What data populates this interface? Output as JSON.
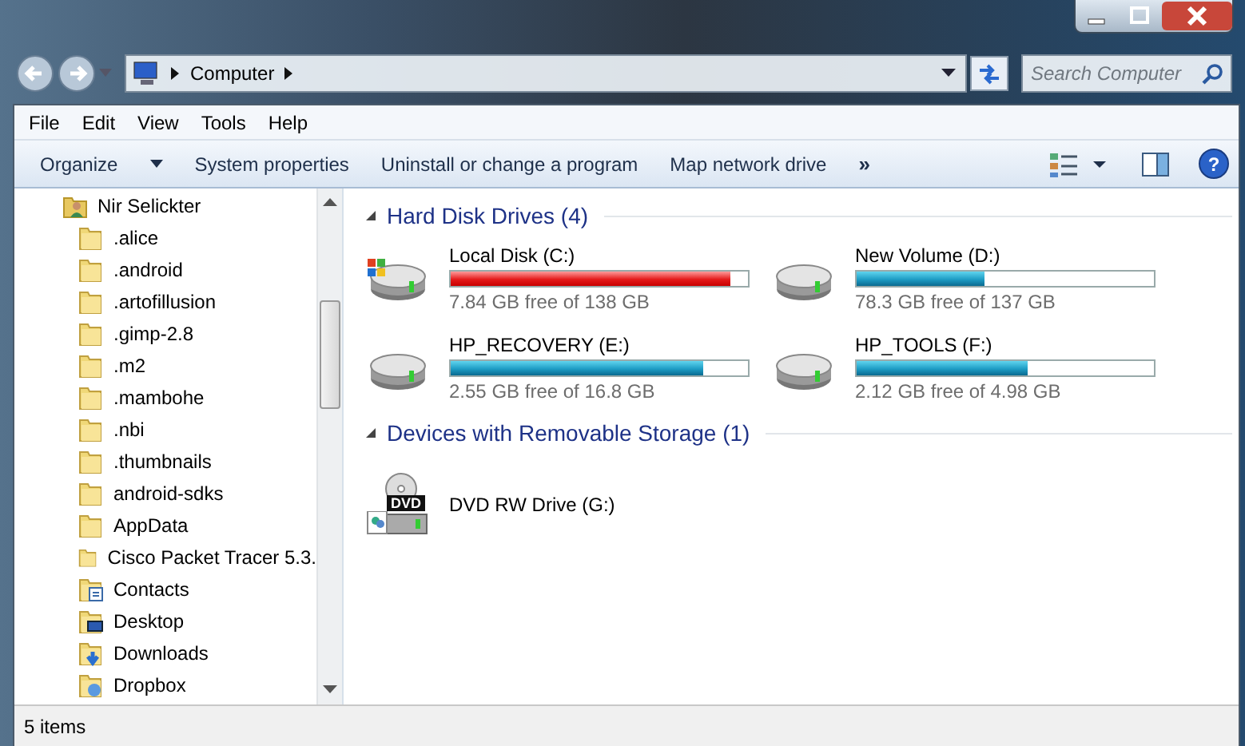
{
  "address_bar": {
    "location": "Computer",
    "search_placeholder": "Search Computer"
  },
  "menu_bar": [
    "File",
    "Edit",
    "View",
    "Tools",
    "Help"
  ],
  "toolbar": {
    "organize": "Organize",
    "actions": [
      "System properties",
      "Uninstall or change a program",
      "Map network drive"
    ],
    "more": "»",
    "help": "?"
  },
  "navigation_tree": {
    "root": {
      "label": "Nir Selickter",
      "children": [
        {
          "label": ".alice",
          "kind": "folder"
        },
        {
          "label": ".android",
          "kind": "folder"
        },
        {
          "label": ".artofillusion",
          "kind": "folder"
        },
        {
          "label": ".gimp-2.8",
          "kind": "folder"
        },
        {
          "label": ".m2",
          "kind": "folder"
        },
        {
          "label": ".mambohe",
          "kind": "folder"
        },
        {
          "label": ".nbi",
          "kind": "folder"
        },
        {
          "label": ".thumbnails",
          "kind": "folder"
        },
        {
          "label": "android-sdks",
          "kind": "folder"
        },
        {
          "label": "AppData",
          "kind": "folder"
        },
        {
          "label": "Cisco Packet Tracer 5.3.",
          "kind": "folder"
        },
        {
          "label": "Contacts",
          "kind": "contacts"
        },
        {
          "label": "Desktop",
          "kind": "desktop"
        },
        {
          "label": "Downloads",
          "kind": "downloads"
        },
        {
          "label": "Dropbox",
          "kind": "dropbox"
        }
      ]
    }
  },
  "groups": [
    {
      "title": "Hard Disk Drives (4)",
      "expanded": true,
      "items": [
        {
          "name": "Local Disk (C:)",
          "kind": "system_disk",
          "level": 0.943,
          "critical": true,
          "free": "7.84 GB free of 138 GB"
        },
        {
          "name": "New Volume (D:)",
          "kind": "disk",
          "level": 0.43,
          "critical": false,
          "free": "78.3 GB free of 137 GB"
        },
        {
          "name": "HP_RECOVERY (E:)",
          "kind": "disk",
          "level": 0.848,
          "critical": false,
          "free": "2.55 GB free of 16.8 GB"
        },
        {
          "name": "HP_TOOLS (F:)",
          "kind": "disk",
          "level": 0.574,
          "critical": false,
          "free": "2.12 GB free of 4.98 GB"
        }
      ]
    },
    {
      "title": "Devices with Removable Storage (1)",
      "expanded": true,
      "items": [
        {
          "name": "DVD RW Drive (G:)",
          "kind": "dvd",
          "icon_text": "DVD"
        }
      ]
    }
  ],
  "status_bar": "5 items"
}
